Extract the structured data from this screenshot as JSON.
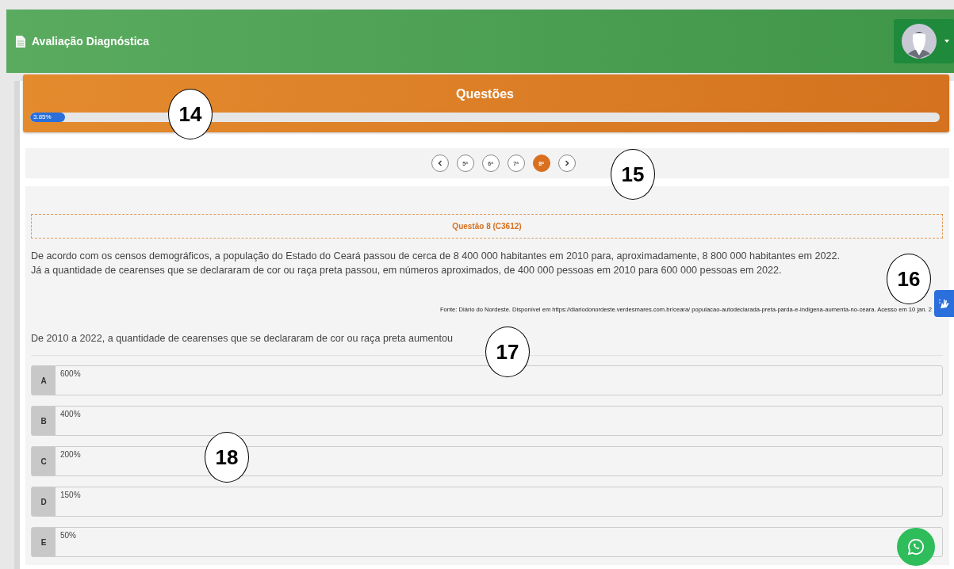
{
  "header": {
    "title": "Avaliação Diagnóstica"
  },
  "progress": {
    "title": "Questões",
    "label": "3.85%",
    "level": 0.0385
  },
  "pager": {
    "pages": [
      {
        "label": "5ª",
        "selected": false
      },
      {
        "label": "6ª",
        "selected": false
      },
      {
        "label": "7ª",
        "selected": false
      },
      {
        "label": "8ª",
        "selected": true
      }
    ]
  },
  "question": {
    "title": "Questão 8 (C3612)",
    "lines": [
      "De acordo com os censos demográficos, a população do Estado do Ceará passou de cerca de 8 400 000 habitantes em 2010 para, aproximadamente, 8 800 000 habitantes em 2022.",
      "Já a quantidade de cearenses que se declararam de cor ou raça preta passou, em números aproximados, de 400 000 pessoas em 2010 para 600 000 pessoas em 2022."
    ],
    "source": "Fonte: Diário do Nordeste. Disponível em https://diariodonordeste.verdesmares.com.br/ceara/ populacao-autodeclarada-preta-parda-e-indigena-aumenta-no-ceara. Acesso em 10 jan. 2",
    "stem": "De 2010 a 2022, a quantidade de cearenses que se declararam de cor ou raça preta aumentou",
    "options": [
      {
        "letter": "A",
        "text": "600%"
      },
      {
        "letter": "B",
        "text": "400%"
      },
      {
        "letter": "C",
        "text": "200%"
      },
      {
        "letter": "D",
        "text": "150%"
      },
      {
        "letter": "E",
        "text": "50%"
      }
    ]
  },
  "callouts": [
    "14",
    "15",
    "16",
    "17",
    "18"
  ]
}
